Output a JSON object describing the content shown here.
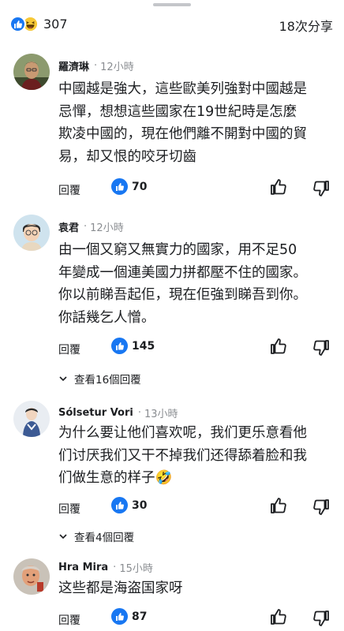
{
  "header": {
    "reaction_count": "307",
    "share_count": "18次分享"
  },
  "comments": [
    {
      "name": "羅濟琳",
      "time": "12小時",
      "lines": [
        "中國越是強大，這些歐美列強對中國越是",
        "忌憚，想想這些國家在19世紀時是怎麼",
        "欺凌中國的，現在他們離不開對中國的貿",
        "易，却又恨的咬牙切齒"
      ],
      "reply_label": "回覆",
      "like_count": "70"
    },
    {
      "name": "袁君",
      "time": "12小時",
      "lines": [
        "由一個又窮又無實力的國家，用不足50",
        "年變成一個連美國力拼都壓不住的國家。",
        "你以前睇吾起佢，現在佢強到睇吾到你。",
        "你話幾乞人憎。"
      ],
      "reply_label": "回覆",
      "like_count": "145",
      "more_replies": "查看16個回覆"
    },
    {
      "name": "Sólsetur Vori",
      "time": "13小時",
      "lines": [
        "为什么要让他们喜欢呢，我们更乐意看他",
        "们讨厌我们又干不掉我们还得舔着脸和我",
        "们做生意的样子🤣"
      ],
      "reply_label": "回覆",
      "like_count": "30",
      "more_replies": "查看4個回覆"
    },
    {
      "name": "Hra Mira",
      "time": "15小時",
      "lines": [
        "这些都是海盗国家呀"
      ],
      "reply_label": "回覆",
      "like_count": "87"
    }
  ],
  "colors": {
    "accent": "#1877f2",
    "text": "#1c1e21",
    "muted": "#8a8d91",
    "haha": "#f7c937"
  }
}
